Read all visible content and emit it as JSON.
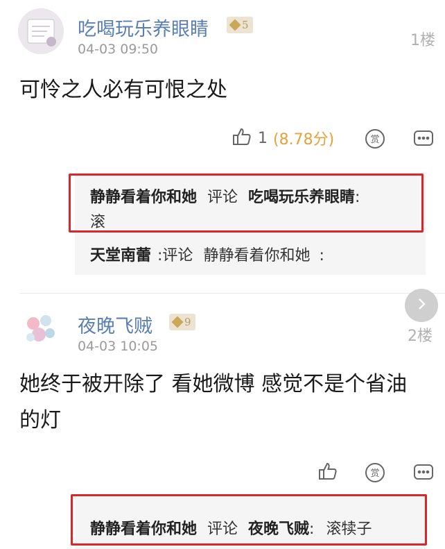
{
  "posts": [
    {
      "username": "吃喝玩乐养眼睛",
      "level": "5",
      "time": "04-03 09:50",
      "floor": "1楼",
      "content": "可怜之人必有可恨之处",
      "likes": "1",
      "score": "(8.78分)",
      "replies": [
        {
          "author": "静静看着你和她",
          "verb": "评论",
          "target": "吃喝玩乐养眼睛",
          "sep": ":",
          "text": "滚"
        },
        {
          "author": "天堂南蕾",
          "verb": ":评论",
          "target": "静静看着你和她",
          "sep": ":",
          "text": ""
        }
      ]
    },
    {
      "username": "夜晚飞贼",
      "level": "9",
      "time": "04-03 10:05",
      "floor": "2楼",
      "content_line1": "她终于被开除了 看她微博 感觉不是个省油",
      "content_line2": "的灯",
      "replies": [
        {
          "author": "静静看着你和她",
          "verb": "评论",
          "target": "夜晚飞贼",
          "sep": ":",
          "text": "滚犊子"
        }
      ]
    }
  ],
  "icons": {
    "like": "thumb-up-icon",
    "reward": "reward-icon",
    "comment": "comment-icon",
    "next": "chevron-right-icon"
  },
  "colors": {
    "username": "#5a7fb5",
    "score": "#e5a23a",
    "highlight_frame": "#d9262b"
  }
}
